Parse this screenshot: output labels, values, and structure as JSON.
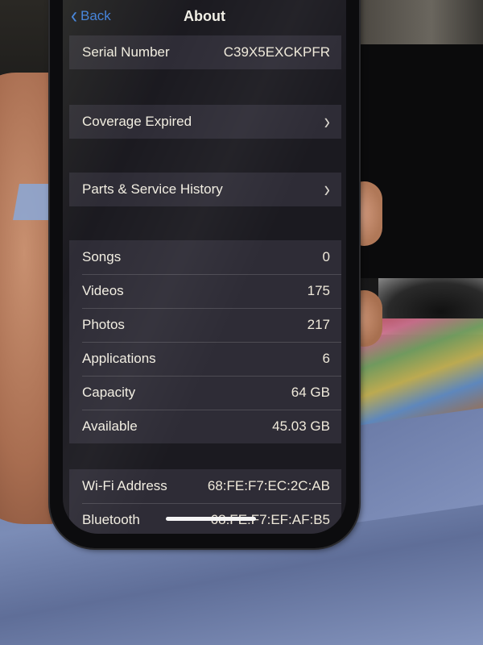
{
  "nav": {
    "back_label": "Back",
    "title": "About"
  },
  "identity": {
    "serial_label": "Serial Number",
    "serial_value": "C39X5EXCKPFR"
  },
  "links": [
    {
      "label": "Coverage Expired"
    },
    {
      "label": "Parts & Service History"
    }
  ],
  "media": [
    {
      "label": "Songs",
      "value": "0"
    },
    {
      "label": "Videos",
      "value": "175"
    },
    {
      "label": "Photos",
      "value": "217"
    },
    {
      "label": "Applications",
      "value": "6"
    },
    {
      "label": "Capacity",
      "value": "64 GB"
    },
    {
      "label": "Available",
      "value": "45.03 GB"
    }
  ],
  "network": [
    {
      "label": "Wi-Fi Address",
      "value": "68:FE:F7:EC:2C:AB"
    },
    {
      "label": "Bluetooth",
      "value": "68:FE:F7:EF:AF:B5"
    }
  ],
  "icons": {
    "back": "chevron-left",
    "disclosure": "chevron-right"
  },
  "colors": {
    "accent": "#3d7fe0",
    "text": "#f2eee2",
    "cell_bg": "#302e38"
  }
}
